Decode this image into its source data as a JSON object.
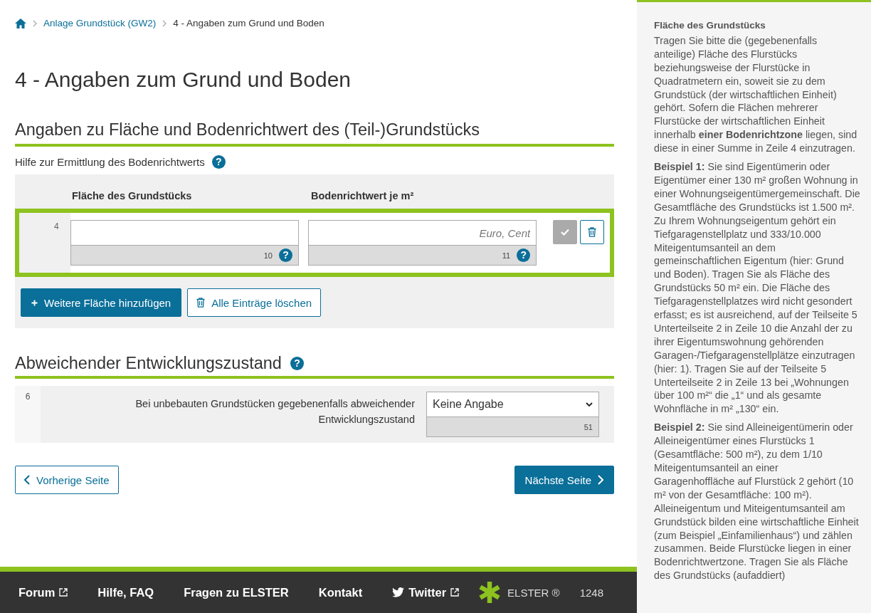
{
  "breadcrumb": [
    {
      "label": "Anlage Grundstück (GW2)",
      "kind": "link"
    },
    {
      "label": "4 - Angaben zum Grund und Boden",
      "kind": "current"
    }
  ],
  "page_title": "4 - Angaben zum Grund und Boden",
  "section1": {
    "title": "Angaben zu Fläche und Bodenrichtwert des (Teil-)Grundstücks",
    "help_link": "Hilfe zur Ermittlung des Bodenrichtwerts",
    "help_mark": "?",
    "columns": [
      "Fläche des Grundstücks",
      "Bodenrichtwert je m²"
    ],
    "rows": [
      {
        "line": "4",
        "confirmed": false,
        "fields": [
          {
            "number": "10",
            "help_mark": "?"
          },
          {
            "placeholder": "Euro, Cent",
            "number": "11",
            "help_mark": "?"
          }
        ]
      }
    ],
    "add_button": "Weitere Fläche hinzufügen",
    "clear_button": "Alle Einträge löschen"
  },
  "section2": {
    "title": "Abweichender Entwicklungszustand",
    "help_mark": "?",
    "line": "6",
    "label": "Bei unbebauten Grundstücken gegebenenfalls abweichender Entwicklungszustand",
    "select_value": "Keine Angabe",
    "number": "51"
  },
  "nav": {
    "previous": "Vorherige Seite",
    "next": "Nächste Seite"
  },
  "footer": {
    "links": [
      {
        "label": "Forum",
        "external": true,
        "kind": "text"
      },
      {
        "label": "Hilfe, FAQ",
        "external": false,
        "kind": "text"
      },
      {
        "label": "Fragen zu ELSTER",
        "external": false,
        "kind": "text"
      },
      {
        "label": "Kontakt",
        "external": false,
        "kind": "text"
      },
      {
        "label": "Twitter",
        "external": true,
        "kind": "twitter"
      }
    ],
    "brand": "ELSTER ®",
    "cut_text": "1248"
  },
  "help_panel": {
    "title": "Fläche des Grundstücks",
    "paragraphs": [
      "Tragen Sie bitte die (gegebenenfalls anteilige) Fläche des Flurstücks beziehungsweise der Flurstücke in Quadratmetern ein, soweit sie zu dem Grundstück (der wirtschaftlichen Einheit) gehört. Sofern die Flächen mehrerer Flurstücke der wirtschaftlichen Einheit innerhalb **einer Bodenrichtzone** liegen, sind diese in einer Summe in Zeile 4 einzutragen.",
      "**Beispiel 1:** Sie sind Eigentümerin oder Eigentümer einer 130 m² großen Wohnung in einer Wohnungseigentümergemeinschaft. Die Gesamtfläche des Grundstücks ist 1.500 m². Zu Ihrem Wohnungseigentum gehört ein Tiefgaragenstellplatz und 333/10.000 Miteigentumsanteil an dem gemeinschaftlichen Eigentum (hier: Grund und Boden). Tragen Sie als Fläche des Grundstücks 50 m² ein. Die Fläche des Tiefgaragenstellplatzes wird nicht gesondert erfasst; es ist ausreichend, auf der Teilseite 5 Unterteilseite 2 in Zeile 10 die Anzahl der zu ihrer Eigentumswohnung gehörenden Garagen-/Tiefgaragenstellplätze einzutragen (hier: 1). Tragen Sie auf der Teilseite 5 Unterteilseite 2 in Zeile 13 bei „Wohnungen über 100 m²“ die „1“ und als gesamte Wohnfläche in m² „130“ ein.",
      "**Beispiel 2:** Sie sind Alleineigentümerin oder Alleineigentümer eines Flurstücks 1 (Gesamtfläche: 500 m²), zu dem 1/10 Miteigentumsanteil an einer Garagenhoffläche auf Flurstück 2 gehört (10 m² von der Gesamtfläche: 100 m²). Alleineigentum und Miteigentumsanteil am Grundstück bilden eine wirtschaftliche Einheit (zum Beispiel „Einfamilienhaus“) und zählen zusammen. Beide Flurstücke liegen in einer Bodenrichtwertzone. Tragen Sie als Fläche des Grundstücks (aufaddiert)"
    ]
  }
}
